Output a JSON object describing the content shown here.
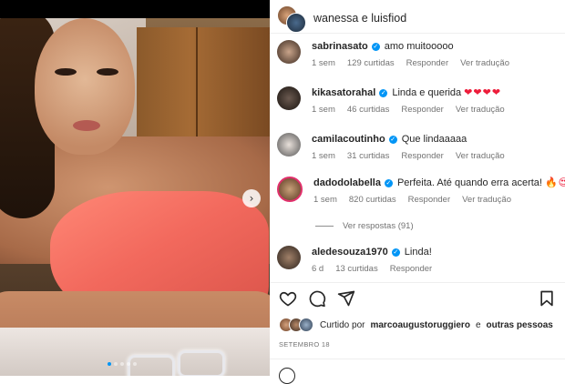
{
  "post": {
    "header": {
      "title": "wanessa e luisfiod"
    },
    "carousel": {
      "slides": 5,
      "active": 1
    }
  },
  "comments": [
    {
      "user": "sabrinasato",
      "verified": true,
      "text": "amo muitooooo",
      "hearts": "",
      "time": "1 sem",
      "likes": "129 curtidas",
      "reply": "Responder",
      "translate": "Ver tradução"
    },
    {
      "user": "kikasatorahal",
      "verified": true,
      "text": "Linda e querida",
      "hearts": "❤❤❤❤",
      "time": "1 sem",
      "likes": "46 curtidas",
      "reply": "Responder",
      "translate": "Ver tradução"
    },
    {
      "user": "camilacoutinho",
      "verified": true,
      "text": "Que lindaaaaa",
      "hearts": "",
      "time": "1 sem",
      "likes": "31 curtidas",
      "reply": "Responder",
      "translate": "Ver tradução"
    },
    {
      "user": "dadodolabella",
      "verified": true,
      "text": "Perfeita. Até quando erra acerta!",
      "hearts": "🔥😍❤",
      "time": "1 sem",
      "likes": "820 curtidas",
      "reply": "Responder",
      "translate": "Ver tradução"
    },
    {
      "user": "aledesouza1970",
      "verified": true,
      "text": "Linda!",
      "hearts": "",
      "time": "6 d",
      "likes": "13 curtidas",
      "reply": "Responder",
      "translate": ""
    }
  ],
  "view_replies": "Ver respostas (91)",
  "likes_line": {
    "prefix": "Curtido por",
    "user": "marcoaugustoruggiero",
    "middle": "e",
    "suffix": "outras pessoas"
  },
  "date": "SETEMBRO 18",
  "icons": {
    "like": "heart-icon",
    "comment": "comment-icon",
    "share": "share-icon",
    "save": "bookmark-icon",
    "next": "chevron-right-icon"
  },
  "colors": {
    "verified": "#0095f6",
    "heart": "#ed1c3a",
    "muted": "#737373",
    "text": "#262626"
  }
}
